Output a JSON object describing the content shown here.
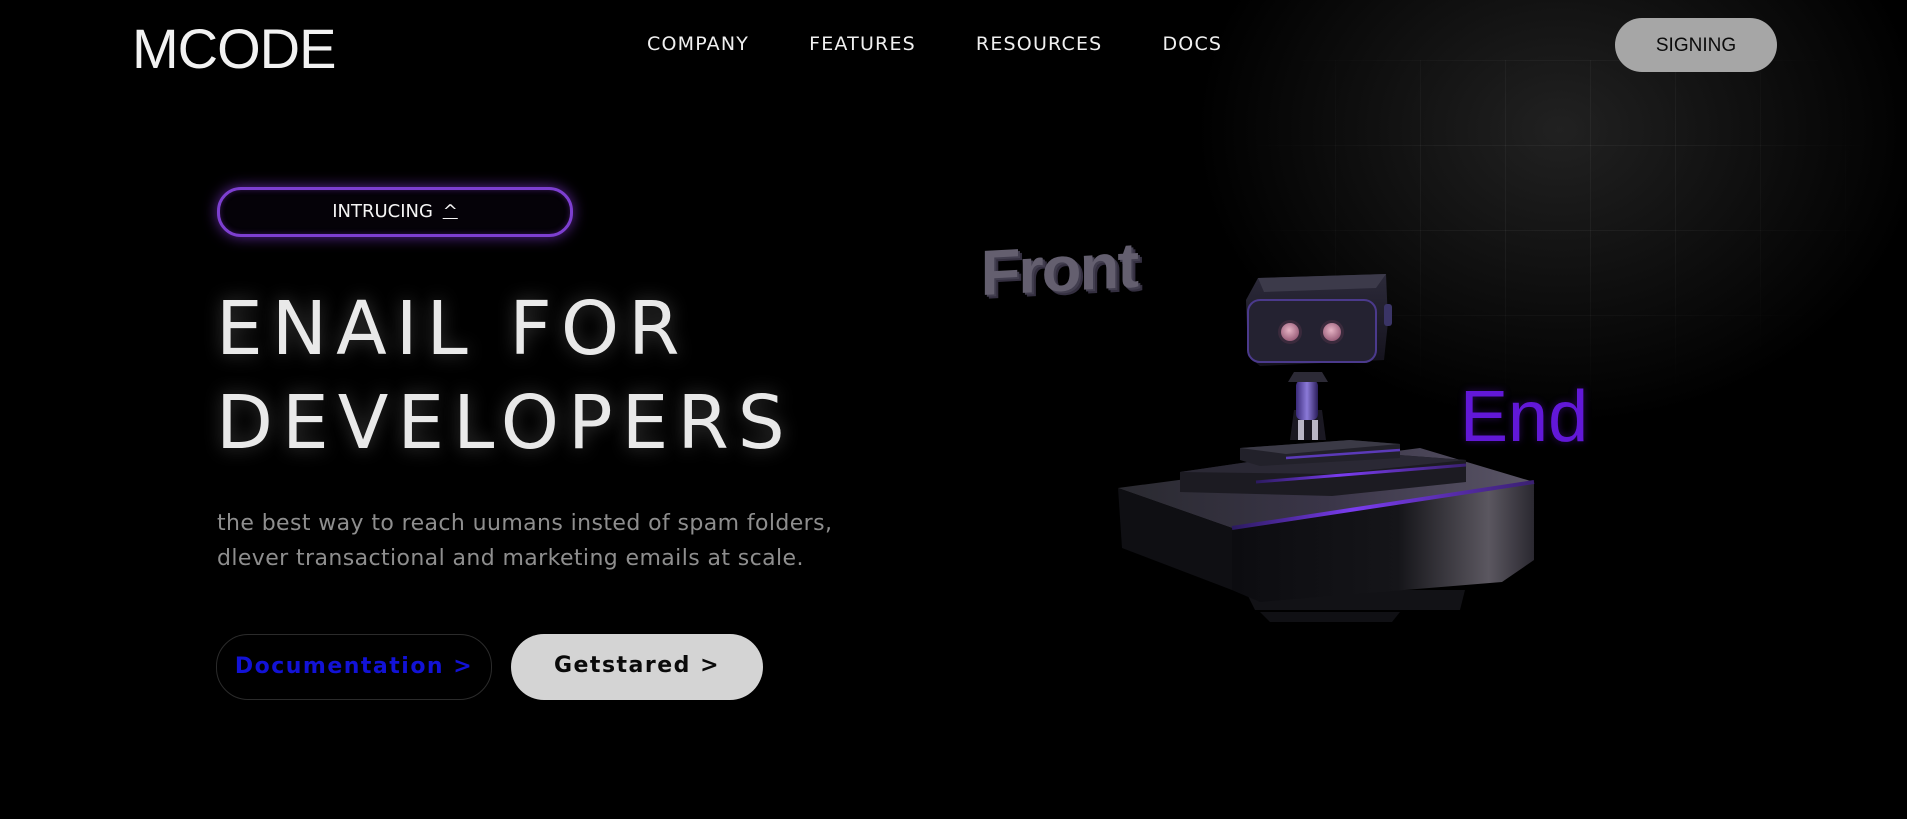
{
  "brand": {
    "logo": "MCODE"
  },
  "nav": {
    "items": [
      {
        "label": "COMPANY"
      },
      {
        "label": "FEATURES"
      },
      {
        "label": "RESOURCES"
      },
      {
        "label": "DOCS"
      }
    ],
    "signin_label": "SIGNING"
  },
  "hero": {
    "badge_text": "INTRUCING",
    "badge_caret": "^",
    "headline_line1": "ENAIL FOR",
    "headline_line2": "DEVELOPERS",
    "subtitle_line1": "the best way to reach uumans insted of spam folders,",
    "subtitle_line2": "dlever transactional and marketing emails at scale.",
    "docs_button": "Documentation >",
    "start_button": "Getstared >"
  },
  "illustration": {
    "front_label": "Front",
    "end_label": "End",
    "icon": "robot-on-pedestal"
  },
  "colors": {
    "background": "#000000",
    "accent_purple": "#6218d8",
    "badge_border": "#7d3fd0",
    "docs_text": "#1212d6",
    "signin_bg": "#a6a6a6",
    "start_bg": "#d4d4d4"
  }
}
